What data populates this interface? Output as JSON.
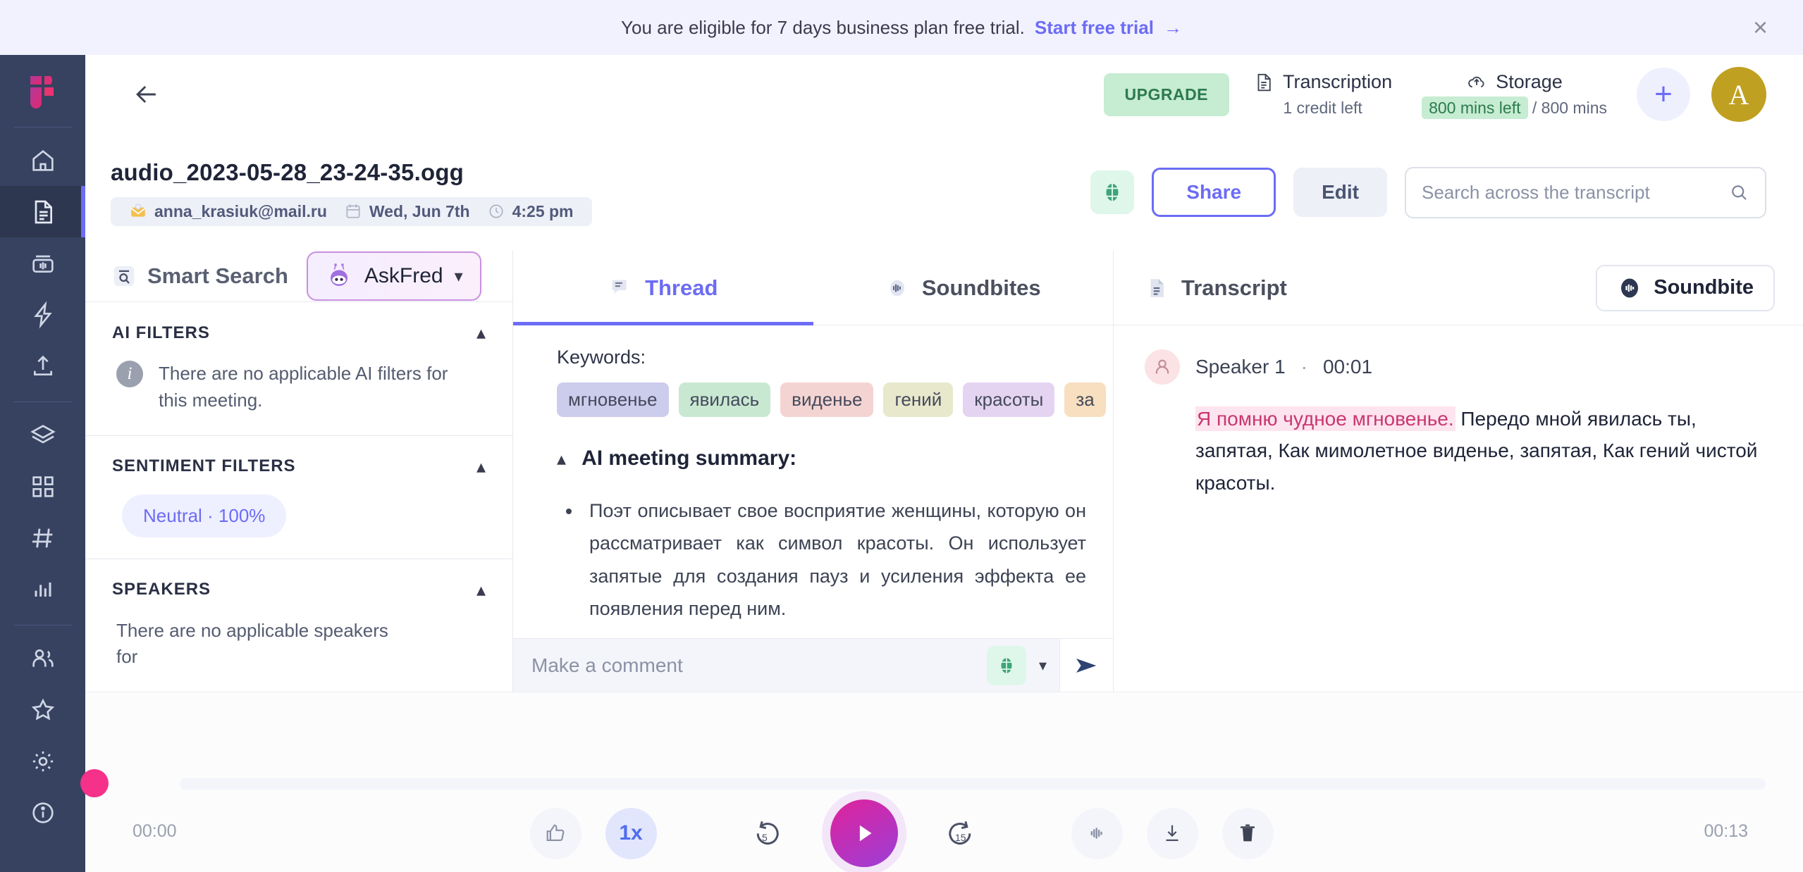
{
  "promo": {
    "text": "You are eligible for 7 days business plan free trial.",
    "link": "Start free trial",
    "arrow": "→",
    "close": "×"
  },
  "appbar": {
    "upgrade_label": "UPGRADE",
    "transcription": {
      "title": "Transcription",
      "detail": "1 credit left"
    },
    "storage": {
      "title": "Storage",
      "pill": "800 mins left",
      "suffix": "/ 800 mins"
    },
    "plus_label": "+",
    "avatar_initial": "A"
  },
  "file": {
    "title": "audio_2023-05-28_23-24-35.ogg",
    "owner": "anna_krasiuk@mail.ru",
    "date": "Wed, Jun 7th",
    "time": "4:25 pm",
    "share_label": "Share",
    "edit_label": "Edit",
    "search_placeholder": "Search across the transcript",
    "search_value": ""
  },
  "left_panel": {
    "smart_search_label": "Smart Search",
    "askfred_label": "AskFred",
    "sections": [
      {
        "title": "AI FILTERS",
        "note": "There are no applicable AI filters for this meeting."
      },
      {
        "title": "SENTIMENT FILTERS",
        "pill": "Neutral · 100%"
      },
      {
        "title": "SPEAKERS",
        "note": "There are no applicable speakers for"
      }
    ]
  },
  "mid_panel": {
    "tabs": [
      {
        "label": "Thread",
        "active": true
      },
      {
        "label": "Soundbites",
        "active": false
      }
    ],
    "keywords_label": "Keywords:",
    "keywords": [
      {
        "text": "мгновенье",
        "color": "#ccccec"
      },
      {
        "text": "явилась",
        "color": "#c9e8d2"
      },
      {
        "text": "виденье",
        "color": "#f4d4d2"
      },
      {
        "text": "гений",
        "color": "#e8e8cc"
      },
      {
        "text": "красоты",
        "color": "#e4d4f2"
      },
      {
        "text": "за",
        "color": "#f7dfc0"
      }
    ],
    "summary_title": "AI meeting summary:",
    "summary_bullets": [
      "Поэт описывает свое восприятие женщины, которую он рассматривает как символ красоты. Он использует запятые для создания пауз и усиления эффекта ее появления перед ним."
    ],
    "comment_placeholder": "Make a comment",
    "comment_value": ""
  },
  "right_panel": {
    "title": "Transcript",
    "soundbite_label": "Soundbite",
    "speaker": "Speaker 1",
    "separator": "·",
    "timestamp": "00:01",
    "highlighted_text": "Я помню чудное мгновенье.",
    "rest_text": " Передо мной явилась ты, запятая, Как мимолетное виденье, запятая, Как гений чистой красоты."
  },
  "player": {
    "current_time": "00:00",
    "total_time": "00:13",
    "speed": "1x",
    "rewind": "5",
    "forward": "15",
    "progress_percent": 0
  },
  "sidebar": {
    "items": [
      {
        "name": "home",
        "active": false
      },
      {
        "name": "document",
        "active": true
      },
      {
        "name": "recordings",
        "active": false
      },
      {
        "name": "automations",
        "active": false
      },
      {
        "name": "upload",
        "active": false
      },
      {
        "name": "layers",
        "active": false
      },
      {
        "name": "apps",
        "active": false
      },
      {
        "name": "channels",
        "active": false
      },
      {
        "name": "analytics",
        "active": false
      },
      {
        "name": "team",
        "active": false
      },
      {
        "name": "favorites",
        "active": false
      },
      {
        "name": "settings",
        "active": false
      },
      {
        "name": "info",
        "active": false
      }
    ]
  },
  "colors": {
    "accent": "#6c6cf5",
    "green": "#c6ecd2",
    "pink": "#f5318a",
    "rail": "#364260"
  }
}
